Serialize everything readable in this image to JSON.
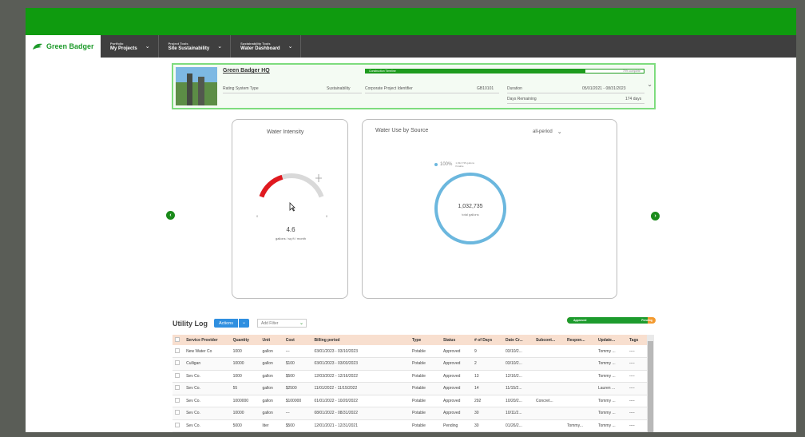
{
  "brand": {
    "name": "Green Badger"
  },
  "nav": [
    {
      "small": "Portfolio",
      "big": "My Projects"
    },
    {
      "small": "Project Tools",
      "big": "Site Sustainability"
    },
    {
      "small": "Sustainability Tools",
      "big": "Water Dashboard"
    }
  ],
  "project": {
    "name": "Green Badger HQ",
    "rating_label": "Rating System Type",
    "rating_value": "Sustainability",
    "corp_label": "Corporate Project Identifier",
    "corp_value": "GB10101",
    "duration_label": "Duration",
    "duration_value": "05/01/2021 - 08/31/2023",
    "days_label": "Days Remaining",
    "days_value": "174 days",
    "timeline_label": "Construction Timeline",
    "timeline_pct_text": "79% complete",
    "timeline_fraction": 0.79
  },
  "water_intensity": {
    "title": "Water Intensity",
    "value": "4.6",
    "unit": "gallons / sq ft / month",
    "gauge_min": "0",
    "gauge_max": "0",
    "gauge_fraction": 0.38
  },
  "water_source": {
    "title": "Water Use by Source",
    "period": "all-period",
    "legend_pct": "100%",
    "legend_value": "1,032,735 gallons",
    "legend_name": "Potable",
    "total": "1,032,735",
    "total_label": "total gallons"
  },
  "utility_log": {
    "title": "Utility Log",
    "actions_label": "Actions",
    "filter_placeholder": "Add Filter",
    "approved_label": "Approved",
    "pending_label": "Pending",
    "approved_fraction": 0.91,
    "columns": [
      "Service Provider",
      "Quantity",
      "Unit",
      "Cost",
      "Billing period",
      "Type",
      "Status",
      "# of Days",
      "Date Cr...",
      "Subcont...",
      "Respon...",
      "Update...",
      "Tags"
    ],
    "rows": [
      [
        "New Water Co",
        "1000",
        "gallon",
        "---",
        "03/01/2023 - 03/10/2023",
        "Potable",
        "Approved",
        "9",
        "03/10/2...",
        "",
        "",
        "Tommy ...",
        "----"
      ],
      [
        "Culligan",
        "10000",
        "gallon",
        "$100",
        "03/01/2023 - 03/03/2023",
        "Potable",
        "Approved",
        "2",
        "03/10/2...",
        "",
        "",
        "Tommy ...",
        "----"
      ],
      [
        "Sev Co.",
        "1000",
        "gallon",
        "$500",
        "12/03/2022 - 12/16/2022",
        "Potable",
        "Approved",
        "13",
        "12/16/2...",
        "",
        "",
        "Tommy ...",
        "----"
      ],
      [
        "Sev Co.",
        "55",
        "gallon",
        "$2500",
        "11/01/2022 - 11/15/2022",
        "Potable",
        "Approved",
        "14",
        "11/15/2...",
        "",
        "",
        "Lauren ...",
        "----"
      ],
      [
        "Sev Co.",
        "1000000",
        "gallon",
        "$100000",
        "01/01/2022 - 10/20/2022",
        "Potable",
        "Approved",
        "292",
        "10/20/2...",
        "Concret...",
        "",
        "Tommy ...",
        "----"
      ],
      [
        "Sev Co.",
        "10000",
        "gallon",
        "---",
        "08/01/2022 - 08/31/2022",
        "Potable",
        "Approved",
        "30",
        "10/11/2...",
        "",
        "",
        "Tommy ...",
        "----"
      ],
      [
        "Sev Co.",
        "5000",
        "liter",
        "$500",
        "12/01/2021 - 12/31/2021",
        "Potable",
        "Pending",
        "30",
        "01/26/2...",
        "",
        "Tommy...",
        "Tommy ...",
        "----"
      ]
    ]
  },
  "colors": {
    "brand_green": "#0f9b0f",
    "gauge_red": "#e0191f",
    "donut_blue": "#6bb7de",
    "actions_blue": "#2f8fe0",
    "pending_orange": "#f39a2f"
  }
}
